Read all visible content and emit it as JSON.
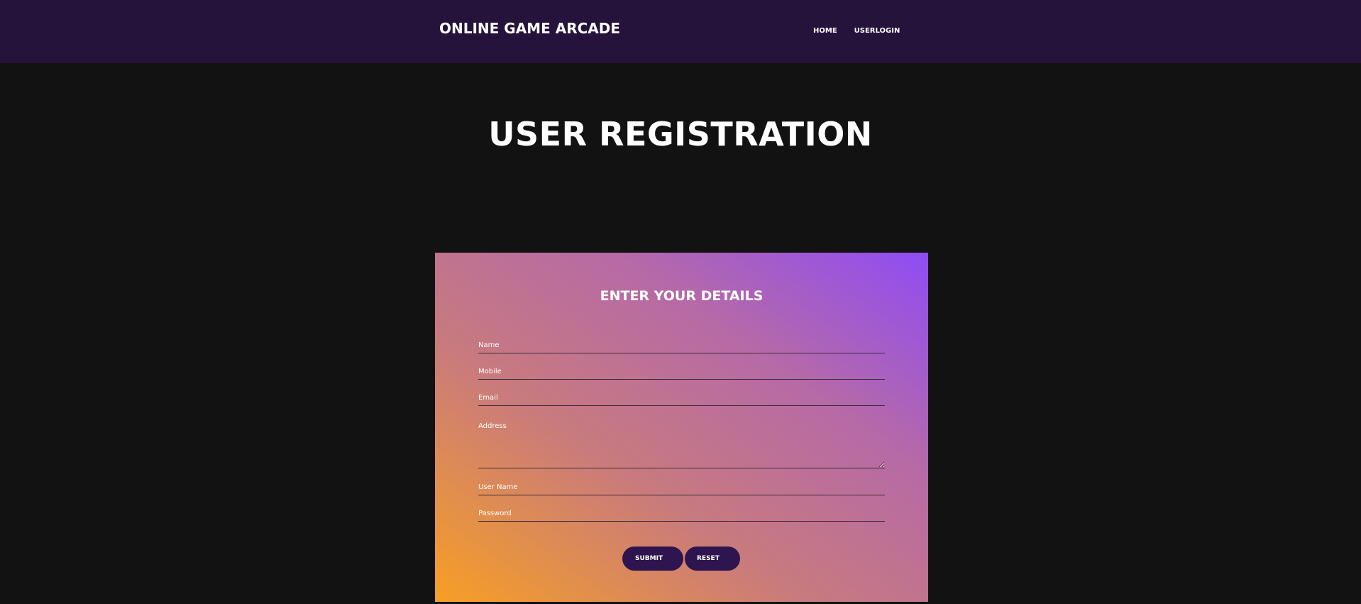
{
  "header": {
    "brand": "ONLINE GAME ARCADE",
    "nav": [
      "HOME",
      "USERLOGIN"
    ]
  },
  "page": {
    "title": "USER REGISTRATION"
  },
  "form": {
    "title": "ENTER YOUR DETAILS",
    "fields": {
      "name": "Name",
      "mobile": "Mobile",
      "email": "Email",
      "address": "Address",
      "username": "User Name",
      "password": "Password"
    },
    "buttons": {
      "submit": "SUBMIT",
      "reset": "RESET"
    }
  },
  "colors": {
    "header_bg": "#26133b",
    "page_bg": "#121212",
    "gradient_start": "#f79f24",
    "gradient_end": "#8f4cf5",
    "button_bg": "#2e1550"
  }
}
